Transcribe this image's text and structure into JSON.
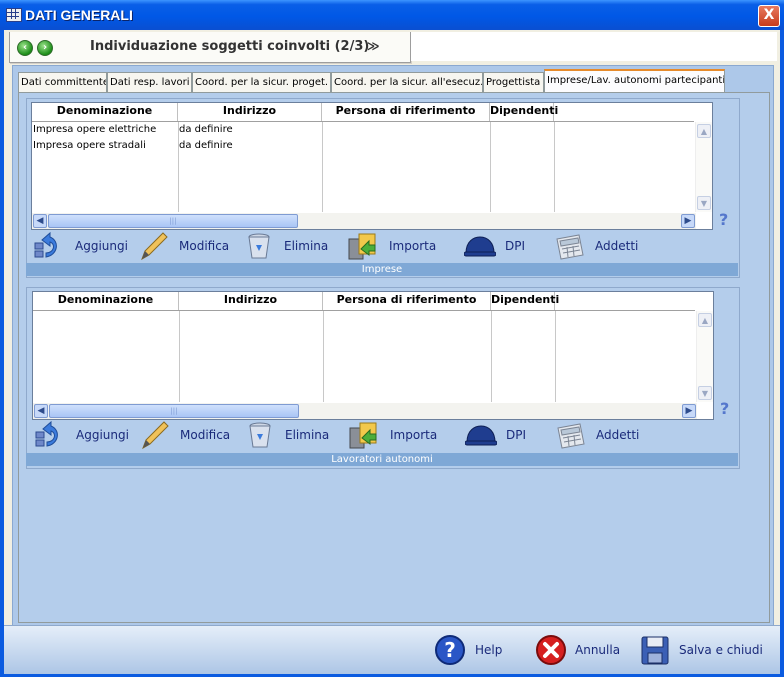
{
  "window": {
    "title": "DATI GENERALI",
    "close_label": "X"
  },
  "step": {
    "title": "Individuazione soggetti coinvolti (2/3)",
    "expand_glyph": "≫"
  },
  "tabs": [
    {
      "label": "Dati committente"
    },
    {
      "label": "Dati resp. lavori"
    },
    {
      "label": "Coord. per la sicur. proget."
    },
    {
      "label": "Coord. per la sicur. all'esecuz."
    },
    {
      "label": "Progettista"
    },
    {
      "label": "Imprese/Lav. autonomi partecipanti"
    }
  ],
  "active_tab": "Imprese/Lav. autonomi partecipanti",
  "imprese": {
    "columns": [
      "Denominazione",
      "Indirizzo",
      "Persona di riferimento",
      "Dipendenti"
    ],
    "rows": [
      {
        "denominazione": "Impresa opere elettriche",
        "indirizzo": "da definire"
      },
      {
        "denominazione": "Impresa opere stradali",
        "indirizzo": "da definire"
      }
    ],
    "caption": "Imprese"
  },
  "lavoratori": {
    "columns": [
      "Denominazione",
      "Indirizzo",
      "Persona di riferimento",
      "Dipendenti"
    ],
    "rows": [],
    "caption": "Lavoratori autonomi"
  },
  "toolbar": {
    "aggiungi": "Aggiungi",
    "modifica": "Modifica",
    "elimina": "Elimina",
    "importa": "Importa",
    "dpi": "DPI",
    "addetti": "Addetti"
  },
  "help_mark": "?",
  "bottom": {
    "help": "Help",
    "annulla": "Annulla",
    "salva": "Salva e chiudi"
  },
  "icons": [
    "grid-icon",
    "back-icon",
    "forward-icon",
    "add-icon",
    "edit-pencil-icon",
    "trash-icon",
    "import-icon",
    "helmet-icon",
    "calculator-icon",
    "help-icon",
    "cancel-icon",
    "save-icon"
  ],
  "colors": {
    "titlebar": "#0058e6",
    "panel": "#b4cdeb",
    "caption": "#7fa8d6",
    "tab_active_accent": "#e68b2c"
  }
}
